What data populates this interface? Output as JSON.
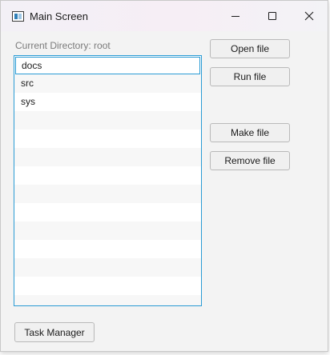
{
  "window": {
    "title": "Main Screen",
    "icon": "app-window-icon",
    "controls": [
      "minimize-icon",
      "maximize-icon",
      "close-icon"
    ]
  },
  "directory": {
    "label": "Current Directory: root"
  },
  "files": {
    "items": [
      "docs",
      "src",
      "sys"
    ],
    "selected": "docs"
  },
  "buttons": {
    "open": "Open file",
    "run": "Run file",
    "make": "Make file",
    "remove": "Remove file",
    "task_manager": "Task Manager"
  },
  "colors": {
    "accent": "#2a9bd4",
    "background": "#f3f3f3"
  }
}
